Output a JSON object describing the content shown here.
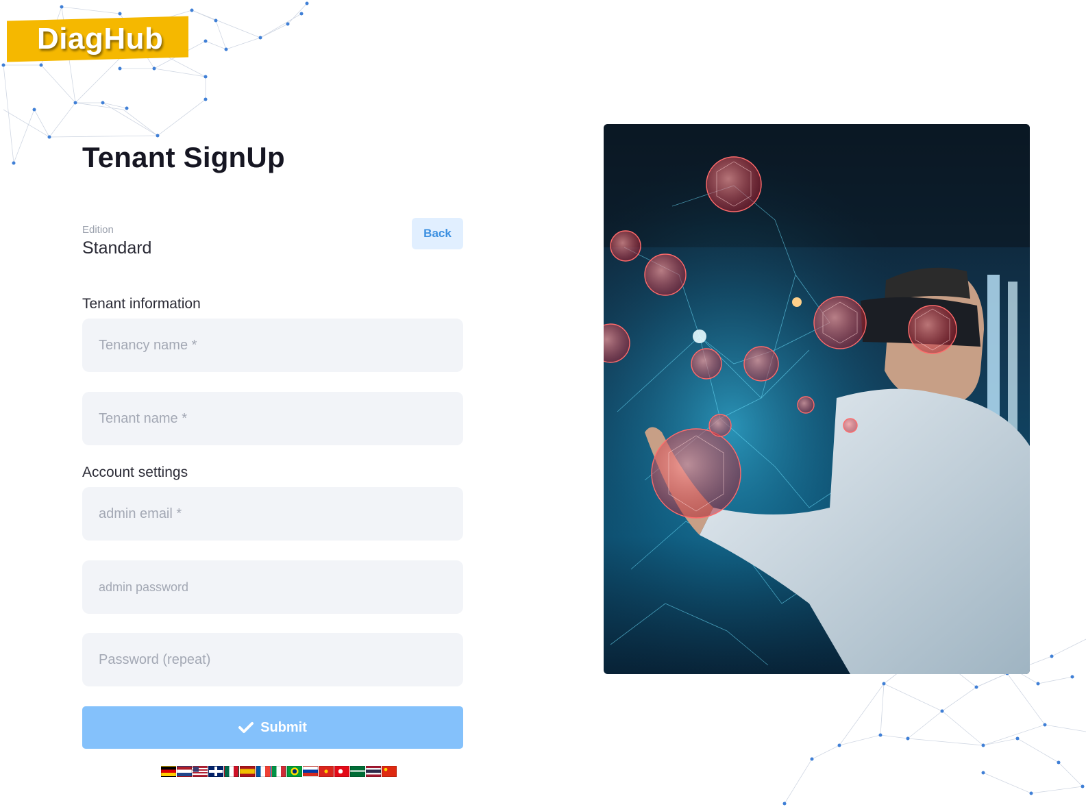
{
  "brand": {
    "logo_text": "DiagHub",
    "logo_color": "#f5b800"
  },
  "page": {
    "title": "Tenant SignUp"
  },
  "edition": {
    "label": "Edition",
    "value": "Standard",
    "back_label": "Back"
  },
  "sections": {
    "tenant_info": "Tenant information",
    "account_settings": "Account settings"
  },
  "fields": {
    "tenancy_name": {
      "placeholder": "Tenancy name *",
      "value": ""
    },
    "tenant_name": {
      "placeholder": "Tenant name *",
      "value": ""
    },
    "admin_email": {
      "placeholder": "admin email *",
      "value": ""
    },
    "admin_password": {
      "placeholder": "admin password",
      "value": ""
    },
    "password_repeat": {
      "placeholder": "Password (repeat)",
      "value": ""
    }
  },
  "submit": {
    "label": "Submit",
    "icon": "check-icon",
    "color": "#84c1fb"
  },
  "languages": [
    "de",
    "nl",
    "us",
    "gb",
    "mx",
    "es",
    "fr",
    "it",
    "br",
    "ru",
    "vn",
    "tr",
    "sa",
    "th",
    "cn"
  ],
  "hero_image": {
    "subject": "man-with-vr-headset-molecules",
    "icon": "hero-image"
  }
}
